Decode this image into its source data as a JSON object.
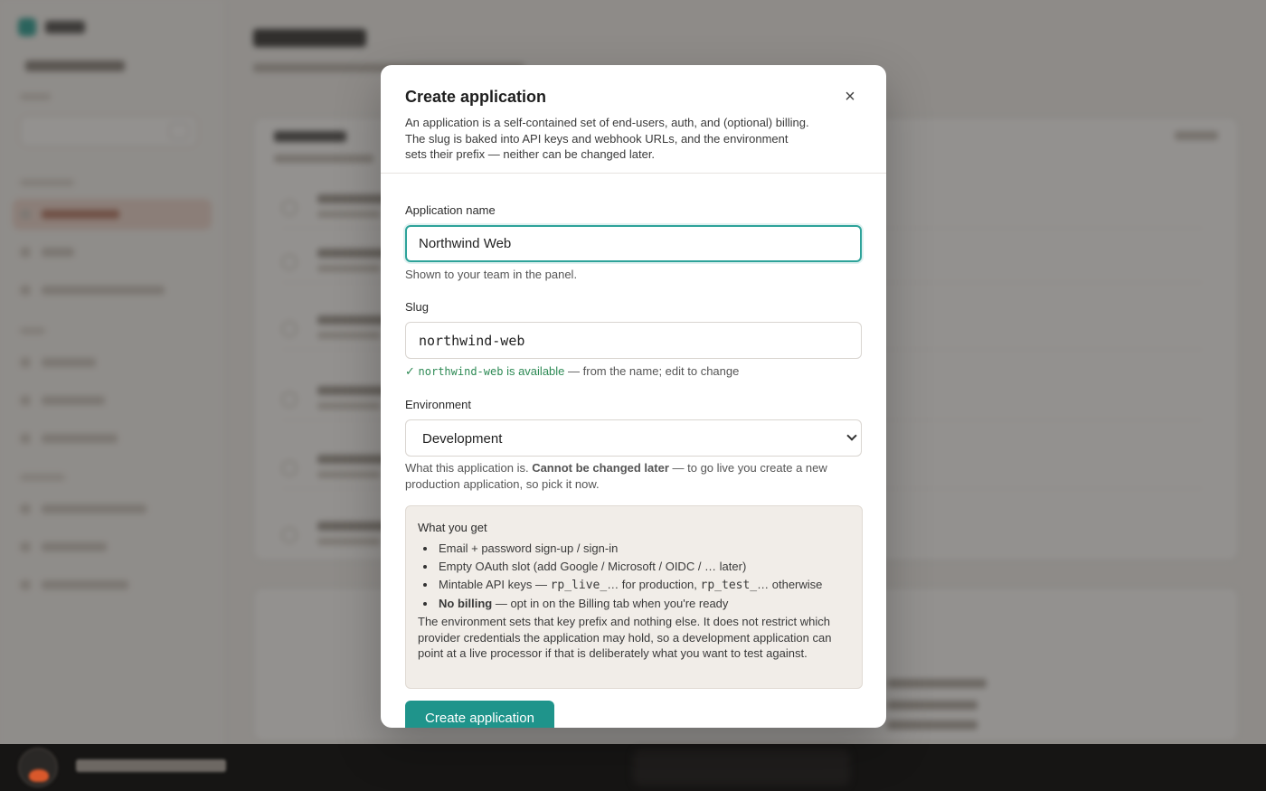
{
  "modal": {
    "title": "Create application",
    "close_glyph": "×",
    "description": "An application is a self-contained set of end-users, auth, and (optional) billing. The slug is baked into API keys and webhook URLs, and the environment sets their prefix — neither can be changed later.",
    "name_field": {
      "label": "Application name",
      "value": "Northwind Web",
      "hint": "Shown to your team in the panel."
    },
    "slug_field": {
      "label": "Slug",
      "value": "northwind-web",
      "status_check": "✓",
      "status_slug": "northwind-web",
      "status_text": "is available",
      "hint_suffix": " — from the name; edit to change"
    },
    "environment_field": {
      "label": "Environment",
      "selected": "Development",
      "hint_prefix": "What this application is. ",
      "hint_bold": "Cannot be changed later",
      "hint_suffix": " — to go live you create a new production application, so pick it now."
    },
    "info_box": {
      "title": "What you get",
      "item_1": "Email + password sign-up / sign-in",
      "item_2": "Empty OAuth slot (add Google / Microsoft / OIDC / … later)",
      "item_3_prefix": "Mintable API keys — ",
      "item_3_live": "rp_live_",
      "item_3_mid": "… for production, ",
      "item_3_test": "rp_test_",
      "item_3_suffix": "… otherwise",
      "item_4_bold": "No billing",
      "item_4_suffix": " — opt in on the Billing tab when you're ready",
      "paragraph": "The environment sets that key prefix and nothing else. It does not restrict which provider credentials the application may hold, so a development application can point at a live processor if that is deliberately what you want to test against."
    },
    "submit_label": "Create application"
  },
  "colors": {
    "accent": "#2ea39a",
    "primary_button": "#1f948b",
    "success": "#2e8a55",
    "info_bg": "#f1ede8"
  }
}
